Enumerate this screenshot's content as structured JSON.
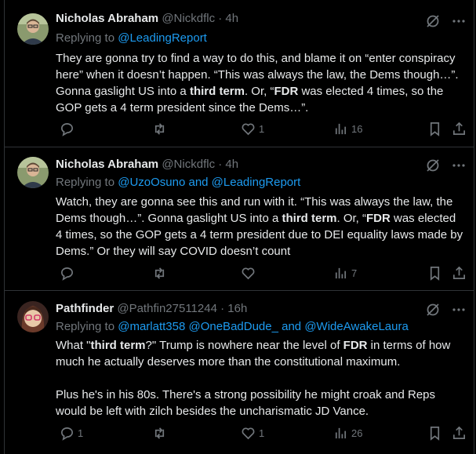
{
  "tweets": [
    {
      "name": "Nicholas Abraham",
      "handle": "@Nickdflc",
      "time": "· 4h",
      "reply_prefix": "Replying to",
      "mentions": "@LeadingReport",
      "body_html": "They are gonna try to find a way to do this, and blame it on “enter conspiracy here” when it doesn’t happen.  “This was always the law, the Dems though…”. Gonna gaslight US into a <b>third term</b>.  Or, “<b>FDR</b> was elected 4 times, so the GOP gets a 4 term president since the Dems…”.",
      "reply_count": "",
      "retweet_count": "",
      "like_count": "1",
      "view_count": "16"
    },
    {
      "name": "Nicholas Abraham",
      "handle": "@Nickdflc",
      "time": "· 4h",
      "reply_prefix": "Replying to",
      "mentions": "@UzoOsuno and @LeadingReport",
      "body_html": "Watch, they are gonna see this and run with it.  “This was always the law, the Dems though…”. Gonna gaslight US into a <b>third term</b>.  Or, “<b>FDR</b> was elected 4 times, so the GOP gets a 4 term president due to DEI equality laws made by Dems.”  Or they will say COVID doesn’t count",
      "reply_count": "",
      "retweet_count": "",
      "like_count": "",
      "view_count": "7"
    },
    {
      "name": "Pathfinder",
      "handle": "@Pathfin27511244",
      "time": "· 16h",
      "reply_prefix": "Replying to",
      "mentions": "@marlatt358 @OneBadDude_ and @WideAwakeLaura",
      "body_html": "<p>What \"<b>third term</b>?\" Trump is nowhere near the level of <b>FDR</b> in terms of how much he actually deserves more than the constitutional maximum.</p><p style=\"margin-top:21px\">Plus he's in his 80s. There's a strong possibility he might croak and Reps would be left with zilch besides the uncharismatic JD Vance.</p>",
      "reply_count": "1",
      "retweet_count": "",
      "like_count": "1",
      "view_count": "26"
    }
  ]
}
